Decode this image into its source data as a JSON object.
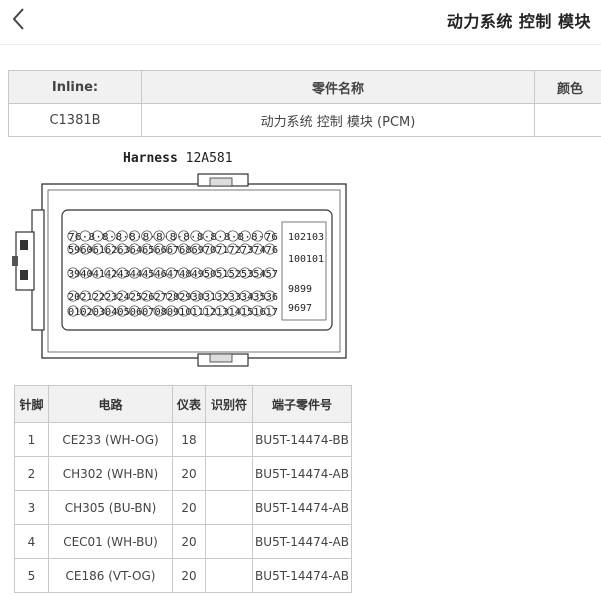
{
  "header": {
    "title": "动力系统 控制 模块",
    "back_icon": "chevron-left-icon"
  },
  "info_table": {
    "headers": [
      "Inline:",
      "零件名称",
      "颜色"
    ],
    "row": [
      "C1381B",
      "动力系统 控制 模块 (PCM)",
      ""
    ]
  },
  "harness": {
    "label": "Harness",
    "id": "12A581"
  },
  "connector": {
    "row1": "76·8·8·8·8·8·8·8·8·8·8·8·8·8·76",
    "row2": "5960616263646566676869707172737476",
    "row3": "3940414243444546474849505152535457",
    "row4": "2021222324252627282930313233343536",
    "row5": "0102030405060708091011121314151617",
    "side1": "102103",
    "side2": "100101",
    "side3": "9899",
    "side4": "9697"
  },
  "pins_table": {
    "headers": [
      "针脚",
      "电路",
      "仪表",
      "识别符",
      "端子零件号"
    ],
    "rows": [
      [
        "1",
        "CE233 (WH-OG)",
        "18",
        "",
        "BU5T-14474-BB"
      ],
      [
        "2",
        "CH302 (WH-BN)",
        "20",
        "",
        "BU5T-14474-AB"
      ],
      [
        "3",
        "CH305 (BU-BN)",
        "20",
        "",
        "BU5T-14474-AB"
      ],
      [
        "4",
        "CEC01 (WH-BU)",
        "20",
        "",
        "BU5T-14474-AB"
      ],
      [
        "5",
        "CE186 (VT-OG)",
        "20",
        "",
        "BU5T-14474-AB"
      ]
    ]
  }
}
